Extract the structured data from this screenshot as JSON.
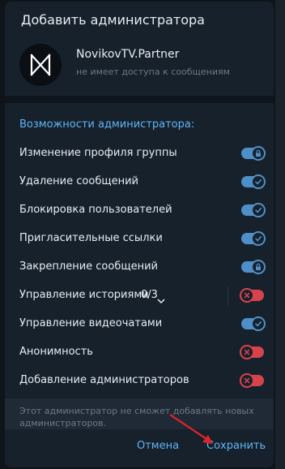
{
  "dialog": {
    "title": "Добавить администратора",
    "user": {
      "name": "NovikovTV.Partner",
      "status": "не имеет доступа к сообщениям"
    },
    "section_title": "Возможности администратора:",
    "permissions": [
      {
        "label": "Изменение профиля группы",
        "state": "on",
        "locked": true
      },
      {
        "label": "Удаление сообщений",
        "state": "on",
        "locked": false
      },
      {
        "label": "Блокировка пользователей",
        "state": "on",
        "locked": false
      },
      {
        "label": "Пригласительные ссылки",
        "state": "on",
        "locked": false
      },
      {
        "label": "Закрепление сообщений",
        "state": "on",
        "locked": true
      },
      {
        "label": "Управление историями",
        "count": "0/3",
        "state": "off",
        "expandable": true
      },
      {
        "label": "Управление видеочатами",
        "state": "on",
        "locked": false
      },
      {
        "label": "Анонимность",
        "state": "off"
      },
      {
        "label": "Добавление администраторов",
        "state": "off"
      }
    ],
    "footnote": "Этот администратор не сможет добавлять новых администраторов.",
    "buttons": {
      "cancel": "Отмена",
      "save": "Сохранить"
    }
  },
  "colors": {
    "accent": "#5eb5f7",
    "toggle_on": "#4f8fc7",
    "toggle_off": "#d6434d",
    "background": "#17212b",
    "annotation_arrow": "#e0242c"
  }
}
